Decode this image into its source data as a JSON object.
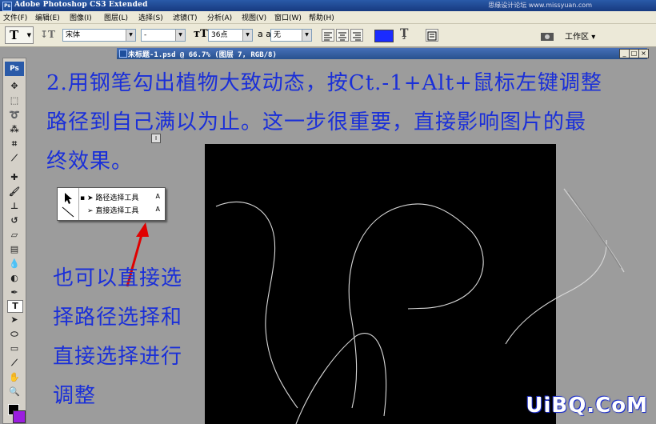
{
  "app": {
    "title": "Adobe Photoshop CS3 Extended",
    "watermark": "思缘设计论坛 www.missyuan.com",
    "ps_badge": "Ps"
  },
  "menu": [
    "文件(F)",
    "编辑(E)",
    "图像(I)",
    "图层(L)",
    "选择(S)",
    "滤镜(T)",
    "分析(A)",
    "视图(V)",
    "窗口(W)",
    "帮助(H)"
  ],
  "options": {
    "tool_letter": "T",
    "font_family": "宋体",
    "font_style": "-",
    "font_size": "36点",
    "antialias_label": "a a",
    "antialias": "无",
    "text_color": "#1a2bff",
    "workspace": "工作区"
  },
  "document": {
    "title": "未标题-1.psd @ 66.7% (图层 7, RGB/8)",
    "min_label": "_",
    "max_label": "□",
    "close_label": "×"
  },
  "instructions": {
    "line1": "2.用钢笔勾出植物大致动态，按Ct.-1+Alt+鼠标左键调整",
    "line2": "路径到自己满以为止。这一步很重要，直接影响图片的最",
    "line3": "终效果。",
    "note1": "也可以直接选",
    "note2": "择路径选择和",
    "note3": "直接选择进行",
    "note4": "调整"
  },
  "flyout": {
    "item1": "路径选择工具",
    "item1_key": "A",
    "item2": "直接选择工具",
    "item2_key": "A"
  },
  "brand": "UiBQ.CoM",
  "colors": {
    "foreground": "#000000",
    "background": "#9b1de0",
    "annotation": "#1a2fd8",
    "arrow": "#e00000"
  }
}
